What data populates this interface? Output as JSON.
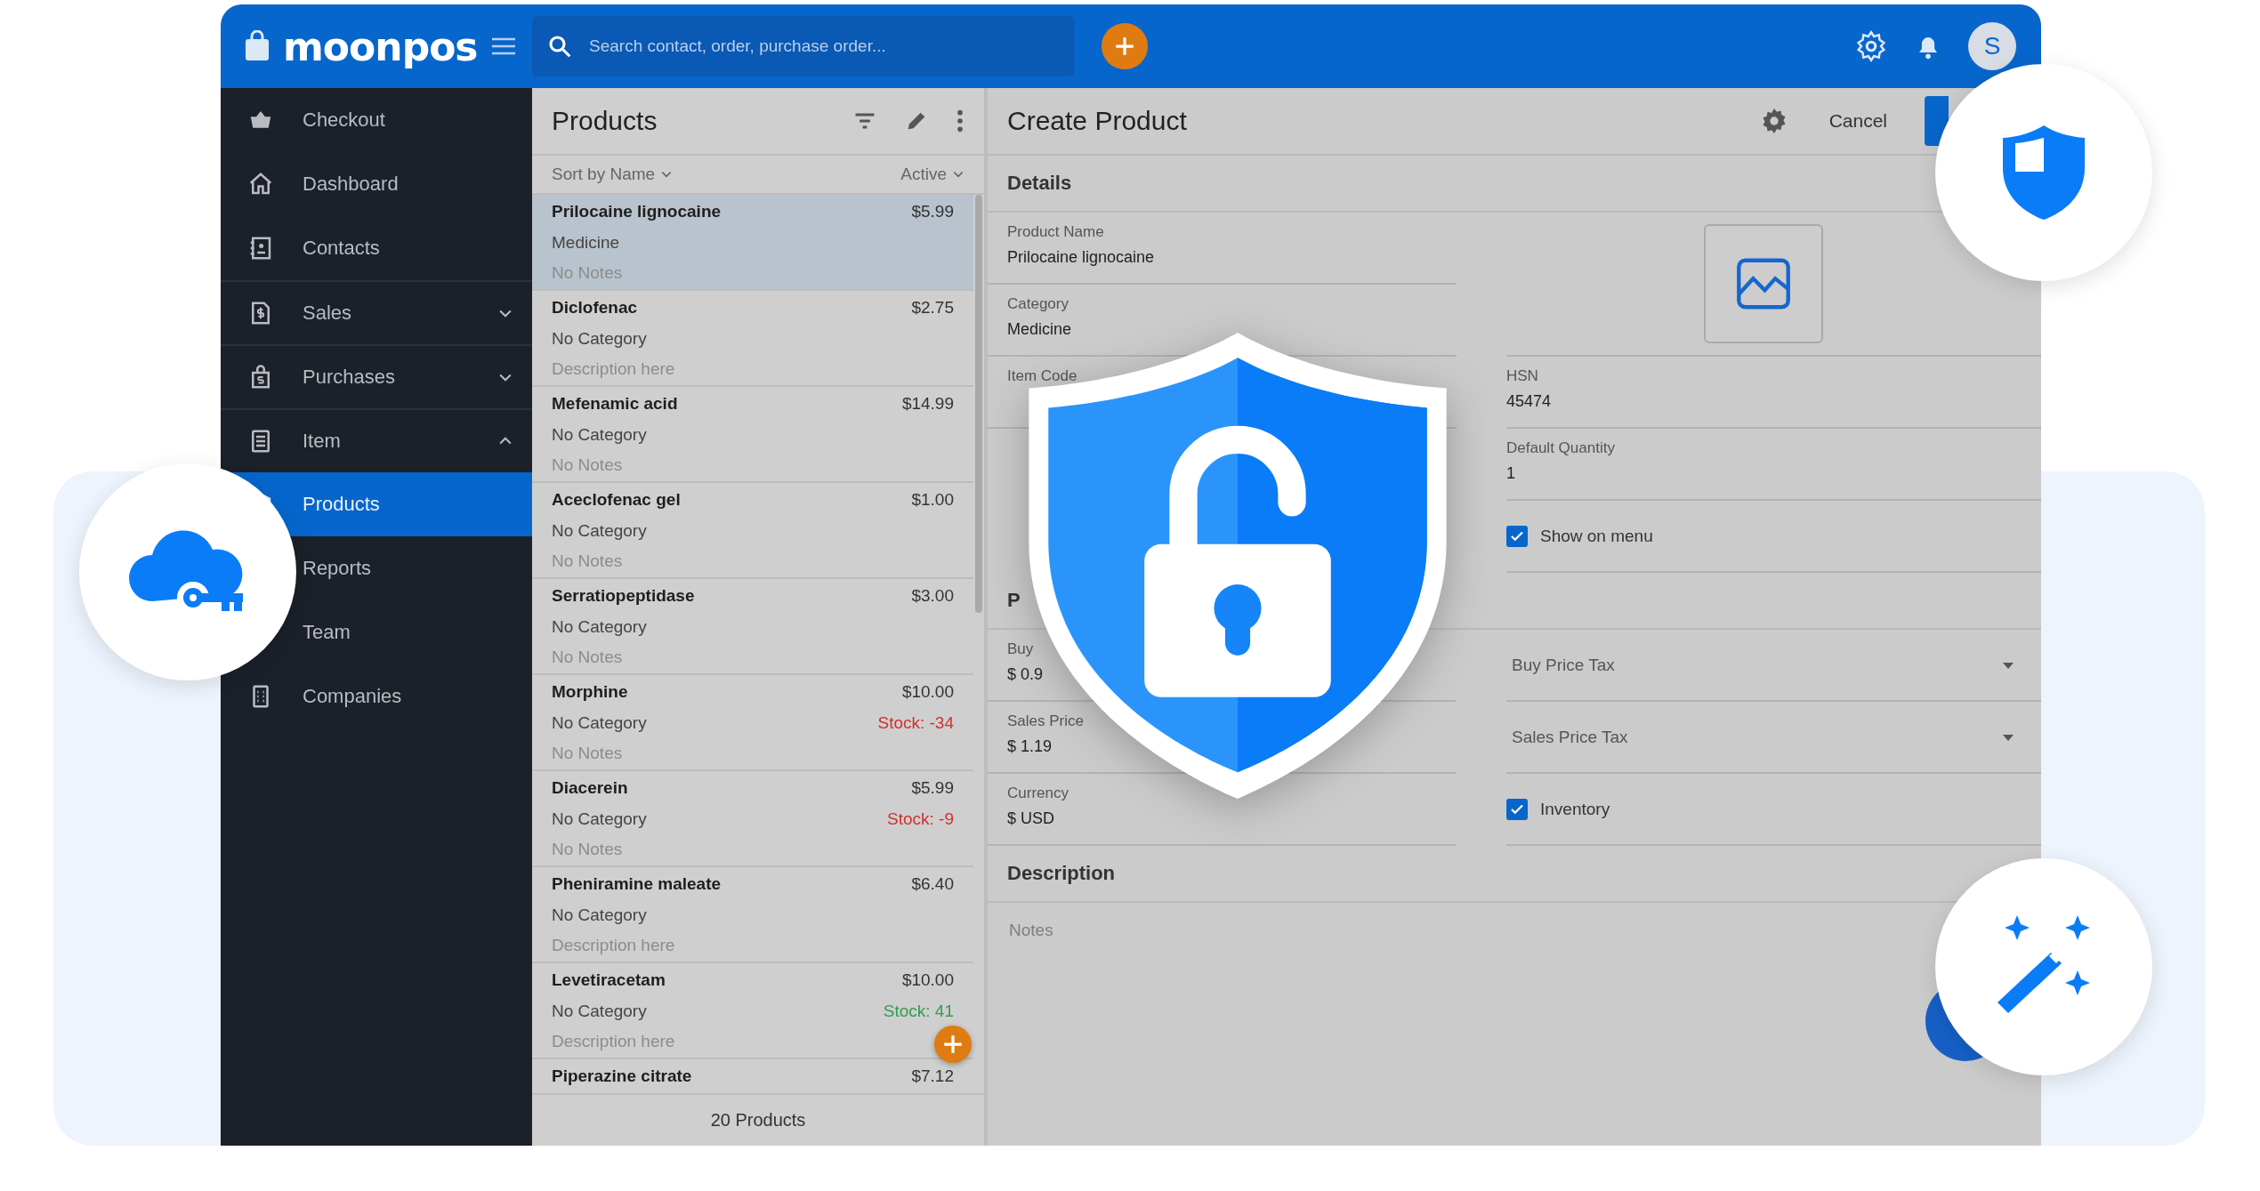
{
  "app": {
    "logo": "moonpos",
    "search": {
      "placeholder": "Search contact, order, purchase order..."
    },
    "user_initial": "S"
  },
  "sidebar": {
    "items": [
      {
        "label": "Checkout",
        "selected": false
      },
      {
        "label": "Dashboard",
        "selected": false
      },
      {
        "label": "Contacts",
        "selected": false
      },
      {
        "label": "Sales",
        "selected": false,
        "expanded": false
      },
      {
        "label": "Purchases",
        "selected": false,
        "expanded": false
      },
      {
        "label": "Item",
        "selected": false,
        "expanded": true
      },
      {
        "label": "Products",
        "selected": true
      },
      {
        "label": "Reports",
        "selected": false
      },
      {
        "label": "Team",
        "selected": false
      },
      {
        "label": "Companies",
        "selected": false
      }
    ]
  },
  "products": {
    "title": "Products",
    "sort": "Sort by Name",
    "filter": "Active",
    "footer": "20 Products",
    "items": [
      {
        "name": "Prilocaine lignocaine",
        "price": "$5.99",
        "category": "Medicine",
        "notes": "No Notes",
        "selected": true
      },
      {
        "name": "Diclofenac",
        "price": "$2.75",
        "category": "No Category",
        "notes": "Description here",
        "selected": false
      },
      {
        "name": "Mefenamic acid",
        "price": "$14.99",
        "category": "No Category",
        "notes": "No Notes",
        "selected": false
      },
      {
        "name": "Aceclofenac gel",
        "price": "$1.00",
        "category": "No Category",
        "notes": "No Notes",
        "selected": false
      },
      {
        "name": "Serratiopeptidase",
        "price": "$3.00",
        "category": "No Category",
        "notes": "No Notes",
        "selected": false
      },
      {
        "name": "Morphine",
        "price": "$10.00",
        "category": "No Category",
        "stock": "Stock:  -34",
        "color": "#d32f2f",
        "notes": "No Notes",
        "selected": false
      },
      {
        "name": "Diacerein",
        "price": "$5.99",
        "category": "No Category",
        "stock": "Stock:  -9",
        "color": "#d32f2f",
        "notes": "No Notes",
        "selected": false
      },
      {
        "name": "Pheniramine maleate",
        "price": "$6.40",
        "category": "No Category",
        "notes": "Description here",
        "selected": false
      },
      {
        "name": "Levetiracetam",
        "price": "$10.00",
        "category": "No Category",
        "stock": "Stock:  41",
        "color": "#2e9e4a",
        "notes": "Description here",
        "selected": false
      },
      {
        "name": "Piperazine citrate",
        "price": "$7.12",
        "selected": false
      }
    ]
  },
  "form": {
    "title": "Create Product",
    "cancel": "Cancel",
    "details": {
      "heading": "Details",
      "fields": [
        {
          "label": "Product Name",
          "value": "Prilocaine lignocaine"
        },
        {
          "label": "Category",
          "value": "Medicine"
        },
        {
          "label": "Item Code"
        }
      ],
      "side": [
        {
          "kind": "image"
        },
        {
          "kind": "field",
          "label": "HSN",
          "value": "45474"
        },
        {
          "kind": "field",
          "label": "Default Quantity",
          "value": "1"
        },
        {
          "kind": "checkbox",
          "label": "Show on menu",
          "checked": true
        }
      ]
    },
    "pricing": {
      "heading": "P",
      "rows": [
        {
          "kind": "field",
          "label": "Buy",
          "value": "$ 0.9"
        },
        {
          "kind": "select",
          "label": "Buy Price Tax"
        },
        {
          "kind": "field",
          "label": "Sales Price",
          "value": "$ 1.19"
        },
        {
          "kind": "select",
          "label": "Sales Price Tax"
        },
        {
          "kind": "field",
          "label": "Currency",
          "value": "$ USD"
        },
        {
          "kind": "checkbox",
          "label": "Inventory",
          "checked": true
        }
      ]
    },
    "description": {
      "heading": "Description",
      "placeholder": "Notes"
    }
  }
}
